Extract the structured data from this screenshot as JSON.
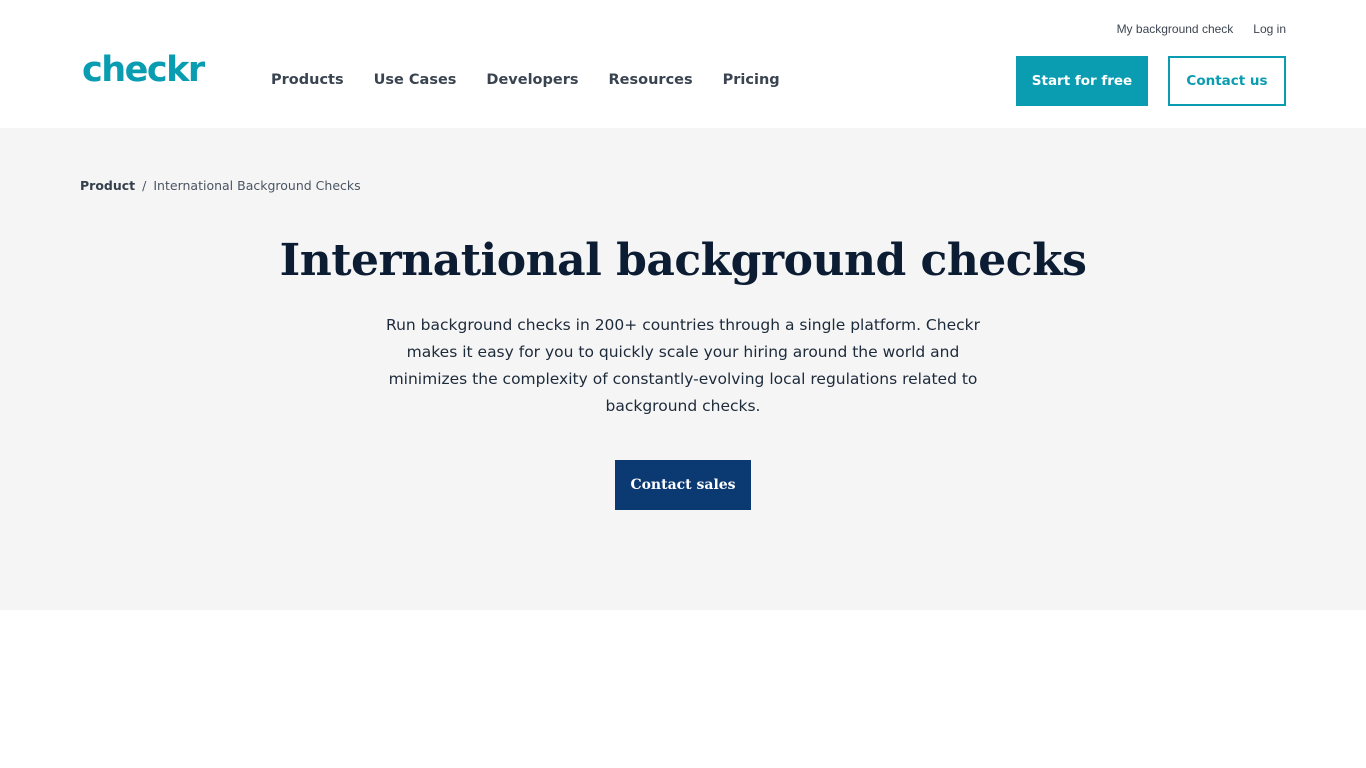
{
  "header": {
    "logo_text": "checkr",
    "top_links": [
      "My background check",
      "Log in"
    ],
    "nav": [
      "Products",
      "Use Cases",
      "Developers",
      "Resources",
      "Pricing"
    ],
    "start_label": "Start for free",
    "contact_label": "Contact us"
  },
  "breadcrumb": {
    "root": "Product",
    "separator": "/",
    "current": "International Background Checks"
  },
  "hero": {
    "title": "International background checks",
    "description": "Run background checks in 200+ countries through a single platform. Checkr makes it easy for you to quickly scale your hiring around the world and minimizes the complexity of constantly-evolving local regulations related to background checks.",
    "cta_label": "Contact sales"
  },
  "colors": {
    "brand": "#0a9cb1",
    "navy": "#0b3a73",
    "hero_bg": "#f5f5f5"
  }
}
